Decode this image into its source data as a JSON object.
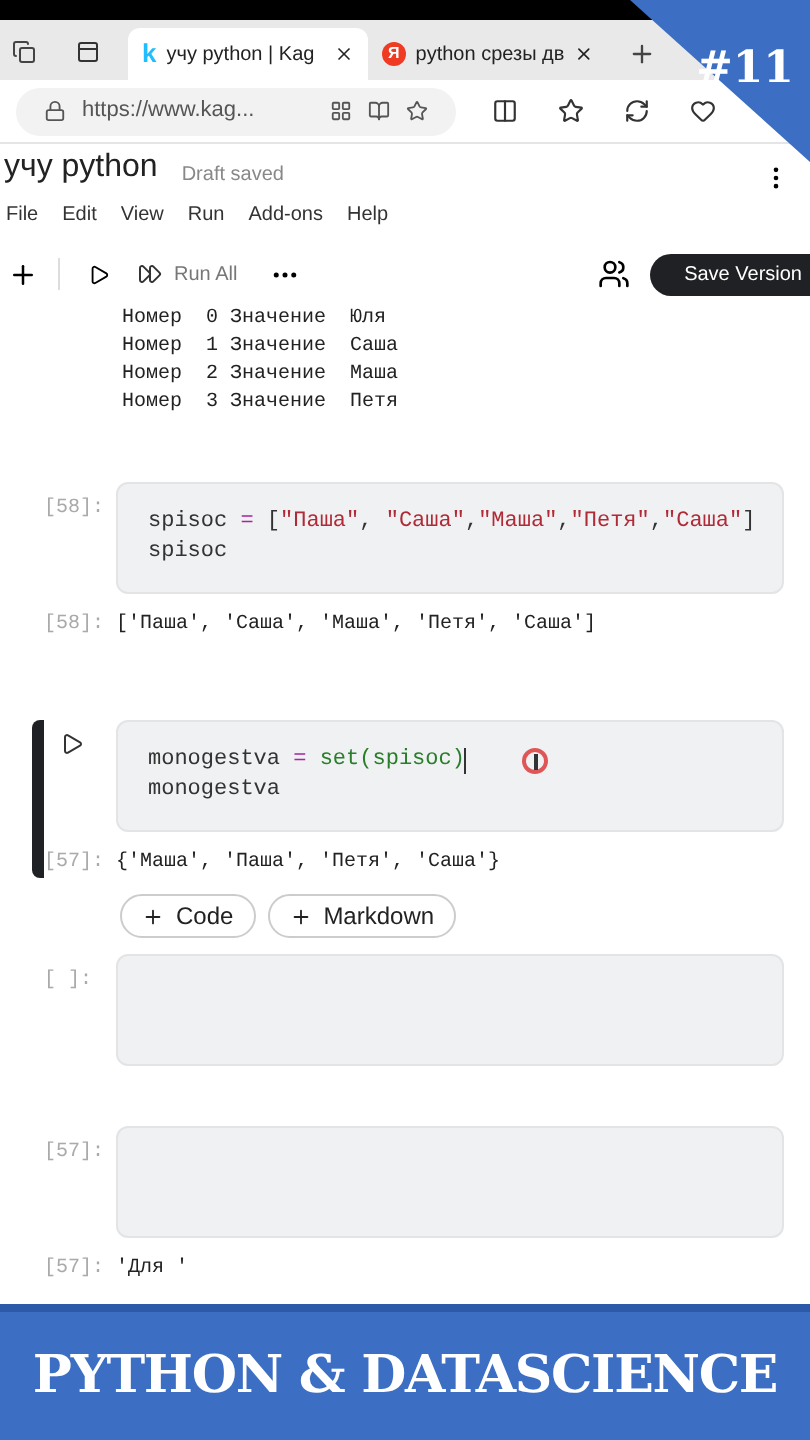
{
  "browser": {
    "tabs": [
      {
        "logo": "k",
        "title": "учу python | Kag",
        "selected": true
      },
      {
        "logo": "Я",
        "title": "python срезы дв",
        "selected": false
      }
    ],
    "url": "https://www.kag..."
  },
  "notebook": {
    "title": "учу python",
    "status": "Draft saved",
    "menu": [
      "File",
      "Edit",
      "View",
      "Run",
      "Add-ons",
      "Help"
    ],
    "run_all": "Run All",
    "save": "Save Version"
  },
  "cells": [
    {
      "kind": "text_output",
      "lines": [
        "Номер  0 Значение  Юля",
        "Номер  1 Значение  Саша",
        "Номер  2 Значение  Маша",
        "Номер  3 Значение  Петя"
      ]
    },
    {
      "kind": "code",
      "prompt": "[58]:",
      "active": false,
      "lines": [
        [
          {
            "t": "spisoc ",
            "kind": "plain"
          },
          {
            "t": "=",
            "kind": "op"
          },
          {
            "t": " [",
            "kind": "plain"
          },
          {
            "t": "\"Паша\"",
            "kind": "string"
          },
          {
            "t": ", ",
            "kind": "plain"
          },
          {
            "t": "\"Саша\"",
            "kind": "string"
          },
          {
            "t": ",",
            "kind": "plain"
          },
          {
            "t": "\"Маша\"",
            "kind": "string"
          },
          {
            "t": ",",
            "kind": "plain"
          },
          {
            "t": "\"Петя\"",
            "kind": "string"
          },
          {
            "t": ",",
            "kind": "plain"
          },
          {
            "t": "\"Саша\"",
            "kind": "string"
          },
          {
            "t": "]",
            "kind": "plain"
          }
        ],
        [
          {
            "t": "spisoc",
            "kind": "plain"
          }
        ]
      ],
      "out_prompt": "[58]:",
      "output": "['Паша', 'Саша', 'Маша', 'Петя', 'Саша']"
    },
    {
      "kind": "code",
      "active": true,
      "lines": [
        [
          {
            "t": "monogestva ",
            "kind": "plain"
          },
          {
            "t": "=",
            "kind": "op"
          },
          {
            "t": " set(spisoc)",
            "kind": "func"
          }
        ],
        [
          {
            "t": "monogestva",
            "kind": "plain"
          }
        ]
      ],
      "out_prompt": "[57]:",
      "output": "{'Маша', 'Паша', 'Петя', 'Саша'}"
    },
    {
      "kind": "add_buttons",
      "buttons": [
        "Code",
        "Markdown"
      ]
    },
    {
      "kind": "code",
      "prompt": "[ ]:",
      "active": false
    },
    {
      "kind": "code",
      "prompt": "[57]:",
      "active": false,
      "out_prompt": "[57]:",
      "output": "'Для '"
    }
  ],
  "corner_badge": "#11",
  "banner": "PYTHON & DATASCIENCE"
}
